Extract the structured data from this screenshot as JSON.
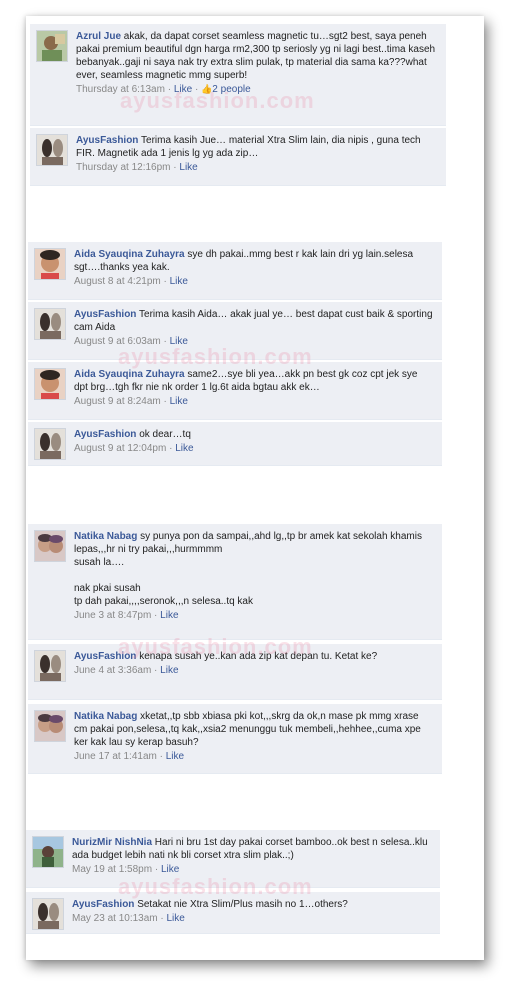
{
  "watermark": "ayusfashion.com",
  "comments": [
    {
      "author": "Azrul Jue",
      "text": "akak, da dapat corset seamless magnetic tu…sgt2 best, saya peneh pakai premium beautiful dgn harga rm2,300 tp seriosly yg ni lagi best..tima kaseh bebanyak..gaji ni saya nak try extra slim pulak, tp material dia sama ka???what ever, seamless magnetic mmg superb!",
      "time": "Thursday at 6:13am",
      "like": "Like",
      "likes_count": "2 people"
    },
    {
      "author": "AyusFashion",
      "text": "Terima kasih Jue… material Xtra Slim lain, dia nipis , guna tech FIR. Magnetik ada 1 jenis lg yg ada zip…",
      "time": "Thursday at 12:16pm",
      "like": "Like"
    },
    {
      "author": "Aida Syauqina Zuhayra",
      "text": "sye dh pakai..mmg best r kak lain dri yg lain.selesa sgt….thanks yea kak.",
      "time": "August 8 at 4:21pm",
      "like": "Like"
    },
    {
      "author": "AyusFashion",
      "text": "Terima kasih Aida… akak jual ye… best dapat cust baik & sporting cam Aida",
      "time": "August 9 at 6:03am",
      "like": "Like"
    },
    {
      "author": "Aida Syauqina Zuhayra",
      "text": "same2…sye bli yea…akk pn best gk coz cpt jek sye dpt brg…tgh fkr nie nk order 1 lg.6t aida bgtau akk ek…",
      "time": "August 9 at 8:24am",
      "like": "Like"
    },
    {
      "author": "AyusFashion",
      "text": "ok dear…tq",
      "time": "August 9 at 12:04pm",
      "like": "Like"
    },
    {
      "author": "Natika Nabag",
      "text": "sy punya pon da sampai,,ahd lg,,tp br amek kat sekolah khamis lepas,,,hr ni try pakai,,,hurmmmm\nsusah la….\n\nnak pkai susah\ntp dah pakai,,,,seronok,,,n selesa..tq kak",
      "time": "June 3 at 8:47pm",
      "like": "Like"
    },
    {
      "author": "AyusFashion",
      "text": "kenapa susah ye..kan ada zip kat depan tu. Ketat ke?",
      "time": "June 4 at 3:36am",
      "like": "Like"
    },
    {
      "author": "Natika Nabag",
      "text": "xketat,,tp sbb xbiasa pki kot,,,skrg da ok,n mase pk mmg xrase cm pakai pon,selesa,,tq kak,,xsia2 menunggu tuk membeli,,hehhee,,cuma xpe ker kak lau sy kerap basuh?",
      "time": "June 17 at 1:41am",
      "like": "Like"
    },
    {
      "author": "NurizMir NishNia",
      "text": "Hari ni bru 1st day pakai corset bamboo..ok best n selesa..klu ada budget lebih nati nk bli corset xtra slim plak..;)",
      "time": "May 19 at 1:58pm",
      "like": "Like"
    },
    {
      "author": "AyusFashion",
      "text": "Setakat nie Xtra Slim/Plus masih no 1…others?",
      "time": "May 23 at 10:13am",
      "like": "Like"
    }
  ]
}
